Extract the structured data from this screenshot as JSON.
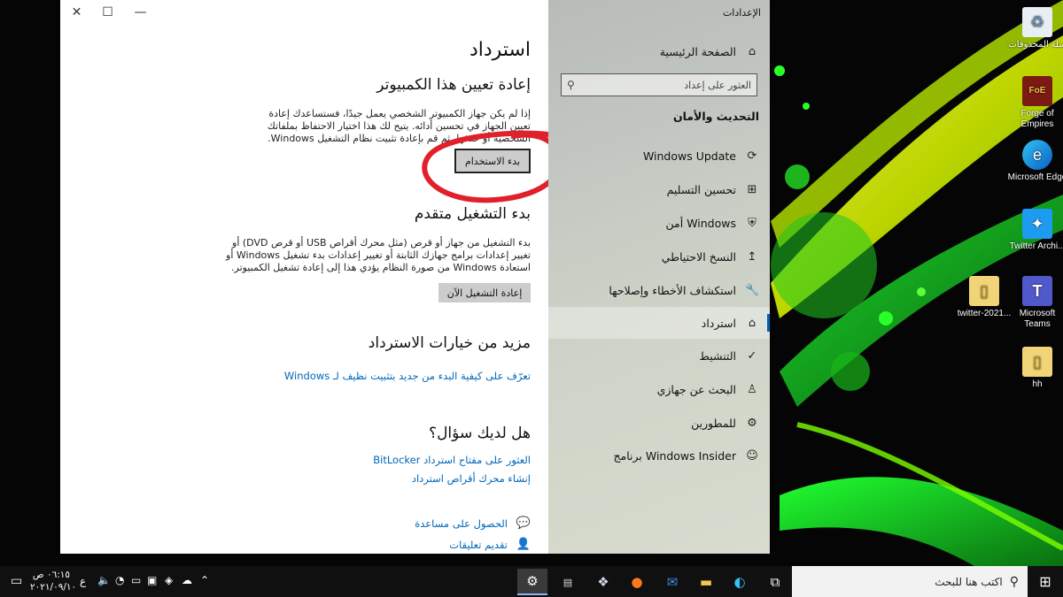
{
  "desktop": {
    "icons": [
      {
        "name": "recycle-bin-icon",
        "label": "سلة المحذوفات"
      },
      {
        "name": "forge-of-empires-icon",
        "label": "Forge of Empires"
      },
      {
        "name": "microsoft-edge-icon",
        "label": "Microsoft Edge"
      },
      {
        "name": "twitter-icon",
        "label": "Twitter Archi..."
      },
      {
        "name": "folder-icon",
        "label": "twitter-2021..."
      },
      {
        "name": "microsoft-teams-icon",
        "label": "Microsoft Teams"
      },
      {
        "name": "folder-icon",
        "label": "hh"
      }
    ]
  },
  "window": {
    "controls": {
      "close": "✕",
      "maximize": "☐",
      "minimize": "—"
    },
    "sidebar": {
      "app_title": "الإعدادات",
      "home": "الصفحة الرئيسية",
      "search_placeholder": "العثور على إعداد",
      "section_heading": "التحديث والأمان",
      "items": [
        {
          "label": "Windows Update",
          "icon": "sync-icon"
        },
        {
          "label": "تحسين التسليم",
          "icon": "delivery-icon"
        },
        {
          "label": "أمن Windows",
          "icon": "shield-icon"
        },
        {
          "label": "النسخ الاحتياطي",
          "icon": "backup-icon"
        },
        {
          "label": "استكشاف الأخطاء وإصلاحها",
          "icon": "wrench-icon"
        },
        {
          "label": "استرداد",
          "icon": "recovery-icon"
        },
        {
          "label": "التنشيط",
          "icon": "activation-icon"
        },
        {
          "label": "البحث عن جهازي",
          "icon": "find-device-icon"
        },
        {
          "label": "للمطورين",
          "icon": "developer-icon"
        },
        {
          "label": "برنامج Windows Insider",
          "icon": "insider-icon"
        }
      ],
      "active_index": 5
    },
    "main": {
      "title": "استرداد",
      "reset": {
        "heading": "إعادة تعيين هذا الكمبيوتر",
        "description": "إذا لم يكن جهاز الكمبيوتر الشخصي يعمل جيدًا، فستساعدك إعادة تعيين الجهاز في تحسين أدائه. يتيح لك هذا اختيار الاحتفاظ بملفاتك الشخصية أو حذفها، ثم قم بإعادة تثبيت نظام التشغيل Windows.",
        "button": "بدء الاستخدام"
      },
      "advanced": {
        "heading": "بدء التشغيل متقدم",
        "description": "بدء التشغيل من جهاز أو قرص (مثل محرك أقراص USB أو قرص DVD) أو تغيير إعدادات برامج جهازك الثابتة أو تغيير إعدادات بدء تشغيل Windows أو استعادة Windows من صورة النظام يؤدي هذا إلى إعادة تشغيل الكمبيوتر.",
        "button": "إعادة التشغيل الآن"
      },
      "more": {
        "heading": "مزيد من خيارات الاسترداد",
        "link": "تعرّف على كيفية البدء من جديد بتثبيت نظيف لـ Windows"
      },
      "question": {
        "heading": "هل لديك سؤال؟",
        "links": [
          "العثور على مفتاح استرداد BitLocker",
          "إنشاء محرك أقراص استرداد"
        ]
      },
      "help": [
        {
          "label": "الحصول على مساعدة",
          "icon": "help-chat-icon"
        },
        {
          "label": "تقديم تعليقات",
          "icon": "feedback-icon"
        }
      ]
    }
  },
  "taskbar": {
    "search_placeholder": "اكتب هنا للبحث",
    "time": "٠٦:١٥ ص",
    "date": "٢٠٢١/٠٩/١٠",
    "lang": "ع",
    "apps": [
      "settings-icon",
      "amazon-icon",
      "dropbox-icon",
      "firefox-icon",
      "mail-icon",
      "file-explorer-icon",
      "edge-icon",
      "task-view-icon"
    ]
  },
  "colors": {
    "accent": "#0063b1",
    "link": "#0067b8",
    "annotation": "#e0202a"
  }
}
